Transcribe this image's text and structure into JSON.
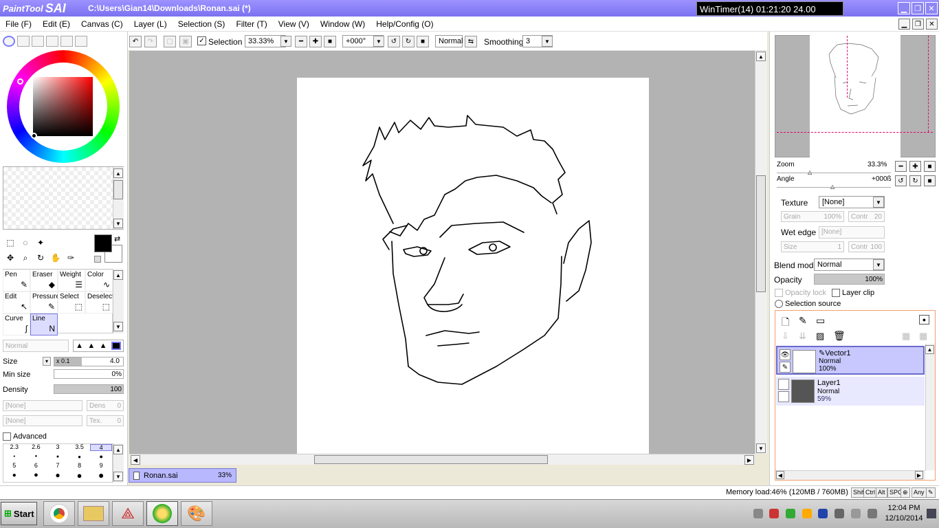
{
  "titlebar": {
    "logo_paint": "PaintTool",
    "logo_sai": "SAI",
    "path": "C:\\Users\\Gian14\\Downloads\\Ronan.sai (*)",
    "wintimer": "WinTimer(14)  01:21:20  24.00"
  },
  "menu": [
    "File (F)",
    "Edit (E)",
    "Canvas (C)",
    "Layer (L)",
    "Selection (S)",
    "Filter (T)",
    "View (V)",
    "Window (W)",
    "Help/Config (O)"
  ],
  "toolbar": {
    "selection_label": "Selection",
    "zoom": "33.33%",
    "angle": "+000°",
    "blend": "Normal",
    "smoothing_label": "Smoothing",
    "smoothing_value": "3"
  },
  "tools": {
    "cells": [
      {
        "name": "Pen",
        "glyph": "✎"
      },
      {
        "name": "Eraser",
        "glyph": "◆"
      },
      {
        "name": "Weight",
        "glyph": "☰"
      },
      {
        "name": "Color",
        "glyph": "∿"
      },
      {
        "name": "Edit",
        "glyph": "↖"
      },
      {
        "name": "Pressure",
        "glyph": "✎"
      },
      {
        "name": "Select",
        "glyph": "⬚"
      },
      {
        "name": "Deselect",
        "glyph": "⬚"
      },
      {
        "name": "Curve",
        "glyph": "∫"
      },
      {
        "name": "Line",
        "glyph": "N"
      }
    ],
    "mode": "Normal",
    "size_label": "Size",
    "size_mult": "x 0.1",
    "size_value": "4.0",
    "minsize_label": "Min size",
    "minsize_value": "0%",
    "density_label": "Density",
    "density_value": "100",
    "none1": "[None]",
    "dens_label": "Dens",
    "dens_value": "0",
    "none2": "[None]",
    "tex_label": "Tex.",
    "tex_value": "0",
    "advanced_label": "Advanced",
    "brush_sizes_top": [
      "2.3",
      "2.6",
      "3",
      "3.5",
      "4"
    ],
    "brush_sizes_bottom": [
      "5",
      "6",
      "7",
      "8",
      "9"
    ]
  },
  "document": {
    "name": "Ronan.sai",
    "zoom": "33%"
  },
  "navigator": {
    "zoom_label": "Zoom",
    "zoom_value": "33.3%",
    "angle_label": "Angle",
    "angle_value": "+000ß"
  },
  "layer_props": {
    "texture_label": "Texture",
    "texture_value": "[None]",
    "grain_label": "Grain",
    "grain_value": "100%",
    "contr_label": "Contr",
    "contr_value": "20",
    "wetedge_label": "Wet edge",
    "wetedge_value": "[None]",
    "size_label": "Size",
    "size_value": "1",
    "contr2_label": "Contr",
    "contr2_value": "100",
    "blend_label": "Blend mode",
    "blend_value": "Normal",
    "opacity_label": "Opacity",
    "opacity_value": "100%",
    "opacitylock_label": "Opacity lock",
    "layerclip_label": "Layer clip",
    "selsource_label": "Selection source"
  },
  "layers": [
    {
      "name": "Vector1",
      "mode": "Normal",
      "opacity": "100%"
    },
    {
      "name": "Layer1",
      "mode": "Normal",
      "opacity": "59%"
    }
  ],
  "status": {
    "memory": "Memory load:46% (120MB / 760MB)",
    "keys": [
      "Shift",
      "Ctrl",
      "Alt",
      "SPC",
      "⊕",
      "Any"
    ]
  },
  "taskbar": {
    "start": "Start",
    "time": "12:04 PM",
    "date": "12/10/2014"
  },
  "colors": {
    "title_bg": "#8a80f5",
    "selection_blue": "#b8b8ff",
    "canvas_gray": "#b3b3b3"
  }
}
